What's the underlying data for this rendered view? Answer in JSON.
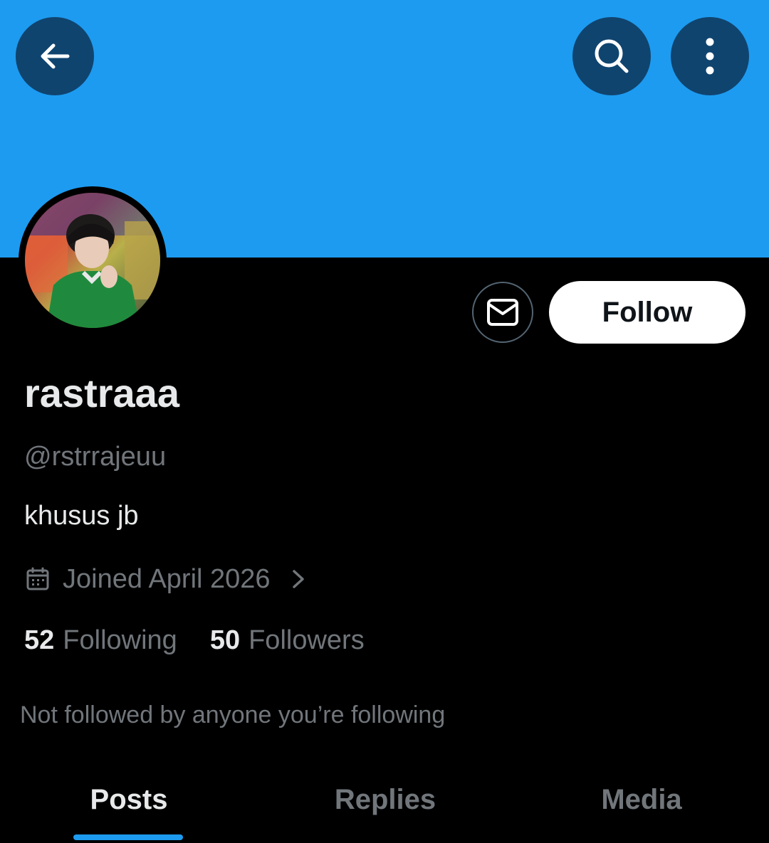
{
  "colors": {
    "banner": "#1d9bf0",
    "background": "#000000",
    "primary_text": "#e7e9ea",
    "secondary_text": "#71767b",
    "accent": "#1d9bf0"
  },
  "top_bar": {
    "back_icon": "arrow-left-icon",
    "search_icon": "search-icon",
    "more_icon": "more-vertical-icon"
  },
  "profile": {
    "display_name": "rastraaa",
    "handle": "@rstrrajeuu",
    "bio": "khusus jb",
    "joined": "Joined April 2026",
    "following_count": "52",
    "following_label": "Following",
    "followers_count": "50",
    "followers_label": "Followers",
    "not_followed_text": "Not followed by anyone you’re following"
  },
  "actions": {
    "message_icon": "envelope-icon",
    "follow_label": "Follow"
  },
  "tabs": [
    {
      "label": "Posts",
      "active": true
    },
    {
      "label": "Replies",
      "active": false
    },
    {
      "label": "Media",
      "active": false
    }
  ]
}
